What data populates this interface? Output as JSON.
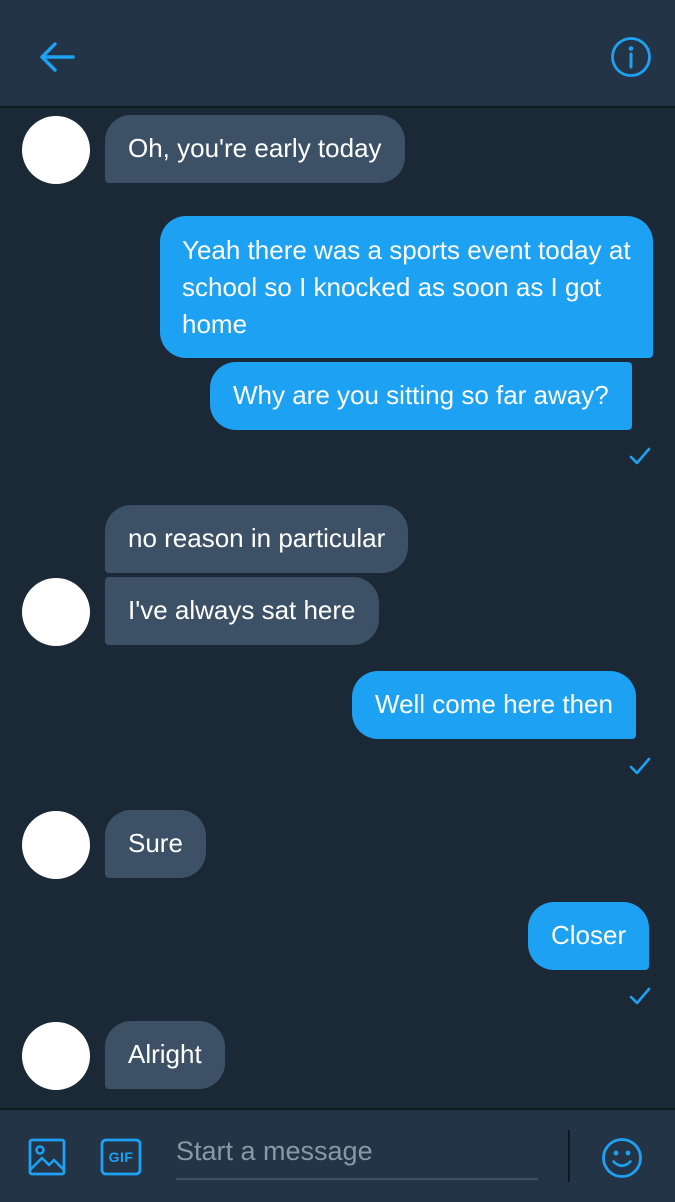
{
  "header": {
    "back_icon": "arrow-left-icon",
    "info_icon": "info-circle-icon",
    "accent": "#1da1f2"
  },
  "thread": {
    "messages": [
      {
        "sender": "them",
        "text": "Oh, you're early today"
      },
      {
        "sender": "me",
        "text": "Yeah there was a sports event today at school so I knocked as soon as I got home"
      },
      {
        "sender": "me",
        "text": "Why are you sitting so far away?",
        "status": "sent-check-icon"
      },
      {
        "sender": "them",
        "text": "no reason in particular"
      },
      {
        "sender": "them",
        "text": "I've always sat here"
      },
      {
        "sender": "me",
        "text": "Well come here then",
        "status": "sent-check-icon"
      },
      {
        "sender": "them",
        "text": "Sure"
      },
      {
        "sender": "me",
        "text": "Closer",
        "status": "sent-check-icon"
      },
      {
        "sender": "them",
        "text": "Alright"
      }
    ],
    "colors": {
      "background": "#1b2836",
      "incoming_bubble": "#3d5166",
      "outgoing_bubble": "#1da1f2"
    }
  },
  "composer": {
    "placeholder": "Start a message",
    "image_icon": "image-icon",
    "gif_label": "GIF",
    "emoji_icon": "emoji-icon"
  }
}
